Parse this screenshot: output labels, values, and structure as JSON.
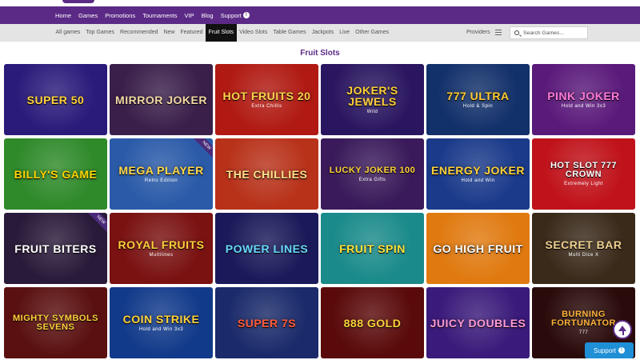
{
  "main_nav": [
    {
      "label": "Home"
    },
    {
      "label": "Games"
    },
    {
      "label": "Promotions"
    },
    {
      "label": "Tournaments"
    },
    {
      "label": "VIP"
    },
    {
      "label": "Blog"
    },
    {
      "label": "Support",
      "badge": "!"
    }
  ],
  "sub_nav": {
    "tabs": [
      {
        "label": "All games"
      },
      {
        "label": "Top Games"
      },
      {
        "label": "Recommended"
      },
      {
        "label": "New"
      },
      {
        "label": "Featured"
      },
      {
        "label": "Fruit Slots",
        "active": true
      },
      {
        "label": "Video Slots"
      },
      {
        "label": "Table Games"
      },
      {
        "label": "Jackpots"
      },
      {
        "label": "Live"
      },
      {
        "label": "Other Games"
      }
    ],
    "providers_label": "Providers",
    "search_placeholder": "Search Games..."
  },
  "section_title": "Fruit Slots",
  "games": [
    {
      "title": "Super 50",
      "bg": "#2a1a7a",
      "fg": "#ffd23a"
    },
    {
      "title": "Mirror Joker",
      "bg": "#3a1f4a",
      "fg": "#f3d9a6"
    },
    {
      "title": "Hot Fruits 20",
      "sub": "Extra Chillis",
      "bg": "#b01a12",
      "fg": "#ffd54a"
    },
    {
      "title": "Joker's Jewels",
      "sub": "Wild",
      "bg": "#2a1660",
      "fg": "#ffcf3a"
    },
    {
      "title": "777 Ultra",
      "sub": "Hold & Spin",
      "bg": "#12306a",
      "fg": "#ffcc33"
    },
    {
      "title": "Pink Joker",
      "sub": "Hold and Win 3x3",
      "bg": "#5a1a7a",
      "fg": "#ff7ad9"
    },
    {
      "title": "Billy's Game",
      "bg": "#2f8a2a",
      "fg": "#ffd400"
    },
    {
      "title": "Mega Player",
      "sub": "Retro Edition",
      "bg": "#2a5aa8",
      "fg": "#ffd84a",
      "badge": "NEW"
    },
    {
      "title": "The Chillies",
      "bg": "#b8321a",
      "fg": "#ffe08a"
    },
    {
      "title": "Lucky Joker 100",
      "sub": "Extra Gifts",
      "bg": "#3a1a5a",
      "fg": "#ffd23a"
    },
    {
      "title": "Energy Joker",
      "sub": "Hold and Win",
      "bg": "#1a3a8a",
      "fg": "#ffd23a"
    },
    {
      "title": "Hot Slot 777 Crown",
      "sub": "Extremely Light",
      "bg": "#c0121a",
      "fg": "#ffffff"
    },
    {
      "title": "Fruit Biters",
      "bg": "#2a1a3a",
      "fg": "#ffffff",
      "badge": "NEW"
    },
    {
      "title": "Royal Fruits",
      "sub": "Multilines",
      "bg": "#7a1212",
      "fg": "#ffcf3a"
    },
    {
      "title": "Power Lines",
      "bg": "#1a1a5a",
      "fg": "#66d9ff"
    },
    {
      "title": "Fruit Spin",
      "bg": "#1a8a8a",
      "fg": "#ffe23a"
    },
    {
      "title": "Go High Fruit",
      "bg": "#e07a10",
      "fg": "#ffffff"
    },
    {
      "title": "Secret Bar",
      "sub": "Multi Dice X",
      "bg": "#3a2a1a",
      "fg": "#f0d090"
    },
    {
      "title": "Mighty Symbols Sevens",
      "bg": "#5a1010",
      "fg": "#ffcf3a"
    },
    {
      "title": "Coin Strike",
      "sub": "Hold and Win 3x3",
      "bg": "#123a8a",
      "fg": "#ffd23a"
    },
    {
      "title": "Super 7s",
      "bg": "#1a2a6a",
      "fg": "#ff5a3a"
    },
    {
      "title": "888 Gold",
      "bg": "#5a0a0a",
      "fg": "#ffd23a"
    },
    {
      "title": "Juicy Doubles",
      "bg": "#3a1a7a",
      "fg": "#ff9ad6"
    },
    {
      "title": "Burning Fortunator",
      "sub": "777",
      "bg": "#2a0a0a",
      "fg": "#ffb23a"
    }
  ],
  "support_button": {
    "label": "Support",
    "badge": "!"
  }
}
